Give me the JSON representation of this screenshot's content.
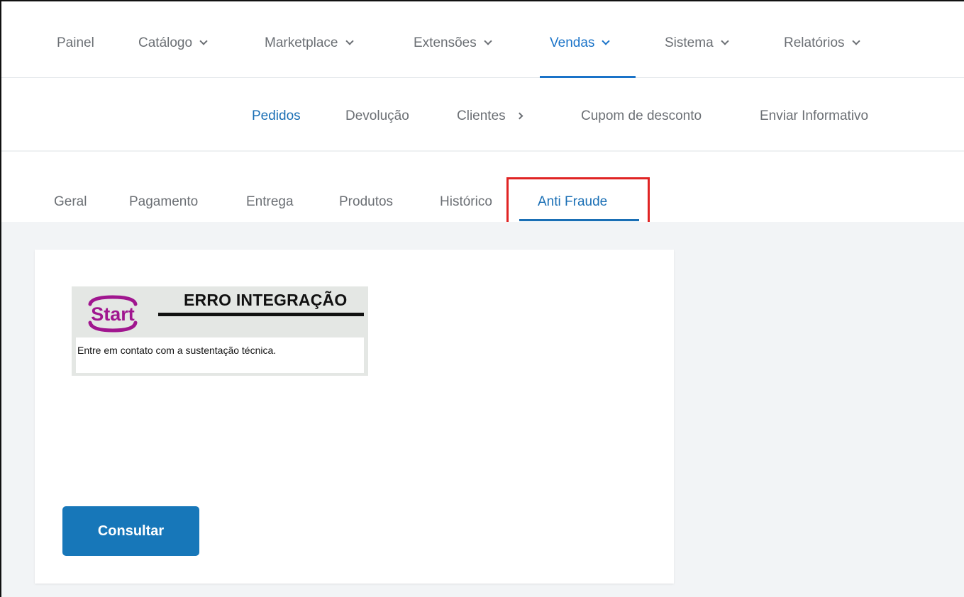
{
  "topnav": {
    "items": [
      {
        "label": "Painel"
      },
      {
        "label": "Catálogo"
      },
      {
        "label": "Marketplace"
      },
      {
        "label": "Extensões"
      },
      {
        "label": "Vendas"
      },
      {
        "label": "Sistema"
      },
      {
        "label": "Relatórios"
      }
    ],
    "active": "Vendas"
  },
  "subnav": {
    "items": [
      {
        "label": "Pedidos"
      },
      {
        "label": "Devolução"
      },
      {
        "label": "Clientes"
      },
      {
        "label": "Cupom de desconto"
      },
      {
        "label": "Enviar Informativo"
      }
    ],
    "active": "Pedidos"
  },
  "tabs": {
    "items": [
      {
        "label": "Geral"
      },
      {
        "label": "Pagamento"
      },
      {
        "label": "Entrega"
      },
      {
        "label": "Produtos"
      },
      {
        "label": "Histórico"
      },
      {
        "label": "Anti Fraude"
      }
    ],
    "active": "Anti Fraude"
  },
  "antifraude": {
    "logo_text": "Start",
    "title": "ERRO INTEGRAÇÃO",
    "message": "Entre em contato com a sustentação técnica.",
    "button_label": "Consultar"
  },
  "colors": {
    "accent": "#1a73c8",
    "button": "#1777b9",
    "highlight": "#e02424",
    "logo": "#a0168f"
  }
}
